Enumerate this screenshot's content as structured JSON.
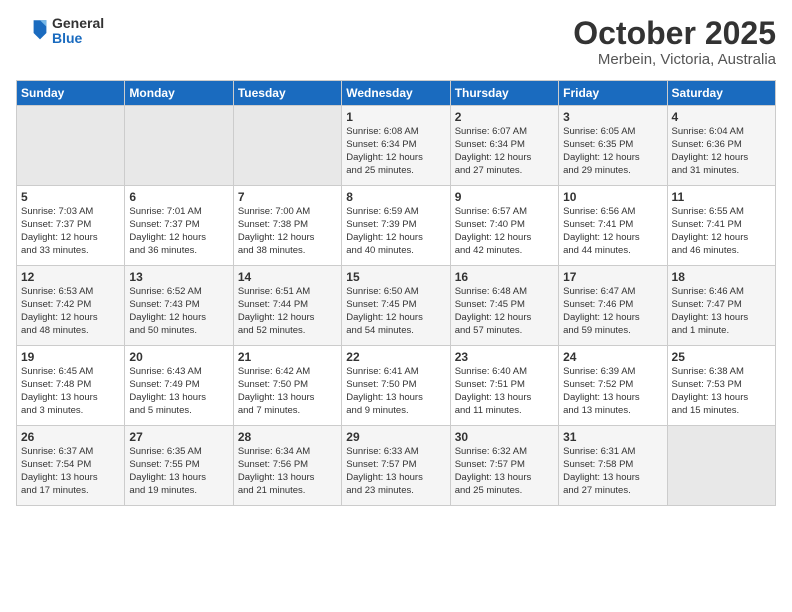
{
  "header": {
    "logo_general": "General",
    "logo_blue": "Blue",
    "month": "October 2025",
    "location": "Merbein, Victoria, Australia"
  },
  "weekdays": [
    "Sunday",
    "Monday",
    "Tuesday",
    "Wednesday",
    "Thursday",
    "Friday",
    "Saturday"
  ],
  "weeks": [
    [
      {
        "day": "",
        "info": ""
      },
      {
        "day": "",
        "info": ""
      },
      {
        "day": "",
        "info": ""
      },
      {
        "day": "1",
        "info": "Sunrise: 6:08 AM\nSunset: 6:34 PM\nDaylight: 12 hours\nand 25 minutes."
      },
      {
        "day": "2",
        "info": "Sunrise: 6:07 AM\nSunset: 6:34 PM\nDaylight: 12 hours\nand 27 minutes."
      },
      {
        "day": "3",
        "info": "Sunrise: 6:05 AM\nSunset: 6:35 PM\nDaylight: 12 hours\nand 29 minutes."
      },
      {
        "day": "4",
        "info": "Sunrise: 6:04 AM\nSunset: 6:36 PM\nDaylight: 12 hours\nand 31 minutes."
      }
    ],
    [
      {
        "day": "5",
        "info": "Sunrise: 7:03 AM\nSunset: 7:37 PM\nDaylight: 12 hours\nand 33 minutes."
      },
      {
        "day": "6",
        "info": "Sunrise: 7:01 AM\nSunset: 7:37 PM\nDaylight: 12 hours\nand 36 minutes."
      },
      {
        "day": "7",
        "info": "Sunrise: 7:00 AM\nSunset: 7:38 PM\nDaylight: 12 hours\nand 38 minutes."
      },
      {
        "day": "8",
        "info": "Sunrise: 6:59 AM\nSunset: 7:39 PM\nDaylight: 12 hours\nand 40 minutes."
      },
      {
        "day": "9",
        "info": "Sunrise: 6:57 AM\nSunset: 7:40 PM\nDaylight: 12 hours\nand 42 minutes."
      },
      {
        "day": "10",
        "info": "Sunrise: 6:56 AM\nSunset: 7:41 PM\nDaylight: 12 hours\nand 44 minutes."
      },
      {
        "day": "11",
        "info": "Sunrise: 6:55 AM\nSunset: 7:41 PM\nDaylight: 12 hours\nand 46 minutes."
      }
    ],
    [
      {
        "day": "12",
        "info": "Sunrise: 6:53 AM\nSunset: 7:42 PM\nDaylight: 12 hours\nand 48 minutes."
      },
      {
        "day": "13",
        "info": "Sunrise: 6:52 AM\nSunset: 7:43 PM\nDaylight: 12 hours\nand 50 minutes."
      },
      {
        "day": "14",
        "info": "Sunrise: 6:51 AM\nSunset: 7:44 PM\nDaylight: 12 hours\nand 52 minutes."
      },
      {
        "day": "15",
        "info": "Sunrise: 6:50 AM\nSunset: 7:45 PM\nDaylight: 12 hours\nand 54 minutes."
      },
      {
        "day": "16",
        "info": "Sunrise: 6:48 AM\nSunset: 7:45 PM\nDaylight: 12 hours\nand 57 minutes."
      },
      {
        "day": "17",
        "info": "Sunrise: 6:47 AM\nSunset: 7:46 PM\nDaylight: 12 hours\nand 59 minutes."
      },
      {
        "day": "18",
        "info": "Sunrise: 6:46 AM\nSunset: 7:47 PM\nDaylight: 13 hours\nand 1 minute."
      }
    ],
    [
      {
        "day": "19",
        "info": "Sunrise: 6:45 AM\nSunset: 7:48 PM\nDaylight: 13 hours\nand 3 minutes."
      },
      {
        "day": "20",
        "info": "Sunrise: 6:43 AM\nSunset: 7:49 PM\nDaylight: 13 hours\nand 5 minutes."
      },
      {
        "day": "21",
        "info": "Sunrise: 6:42 AM\nSunset: 7:50 PM\nDaylight: 13 hours\nand 7 minutes."
      },
      {
        "day": "22",
        "info": "Sunrise: 6:41 AM\nSunset: 7:50 PM\nDaylight: 13 hours\nand 9 minutes."
      },
      {
        "day": "23",
        "info": "Sunrise: 6:40 AM\nSunset: 7:51 PM\nDaylight: 13 hours\nand 11 minutes."
      },
      {
        "day": "24",
        "info": "Sunrise: 6:39 AM\nSunset: 7:52 PM\nDaylight: 13 hours\nand 13 minutes."
      },
      {
        "day": "25",
        "info": "Sunrise: 6:38 AM\nSunset: 7:53 PM\nDaylight: 13 hours\nand 15 minutes."
      }
    ],
    [
      {
        "day": "26",
        "info": "Sunrise: 6:37 AM\nSunset: 7:54 PM\nDaylight: 13 hours\nand 17 minutes."
      },
      {
        "day": "27",
        "info": "Sunrise: 6:35 AM\nSunset: 7:55 PM\nDaylight: 13 hours\nand 19 minutes."
      },
      {
        "day": "28",
        "info": "Sunrise: 6:34 AM\nSunset: 7:56 PM\nDaylight: 13 hours\nand 21 minutes."
      },
      {
        "day": "29",
        "info": "Sunrise: 6:33 AM\nSunset: 7:57 PM\nDaylight: 13 hours\nand 23 minutes."
      },
      {
        "day": "30",
        "info": "Sunrise: 6:32 AM\nSunset: 7:57 PM\nDaylight: 13 hours\nand 25 minutes."
      },
      {
        "day": "31",
        "info": "Sunrise: 6:31 AM\nSunset: 7:58 PM\nDaylight: 13 hours\nand 27 minutes."
      },
      {
        "day": "",
        "info": ""
      }
    ]
  ]
}
